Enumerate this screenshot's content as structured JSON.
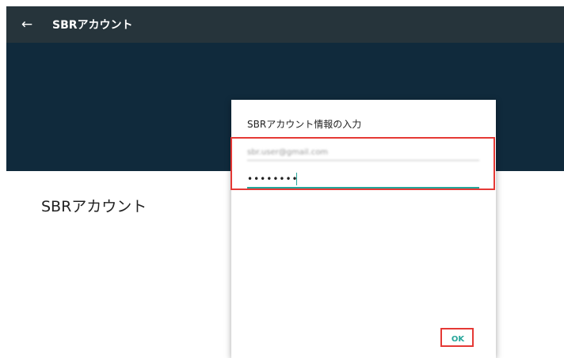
{
  "appbar": {
    "back_icon": "arrow-left-icon",
    "title": "SBRアカウント"
  },
  "page": {
    "heading": "SBRアカウント"
  },
  "dialog": {
    "title": "SBRアカウント情報の入力",
    "email_value": "sbr.user@gmail.com",
    "password_value": "password",
    "ok_label": "OK"
  },
  "colors": {
    "appbar": "#26343b",
    "header": "#102a3c",
    "accent": "#26a69a",
    "highlight": "#e53935"
  }
}
